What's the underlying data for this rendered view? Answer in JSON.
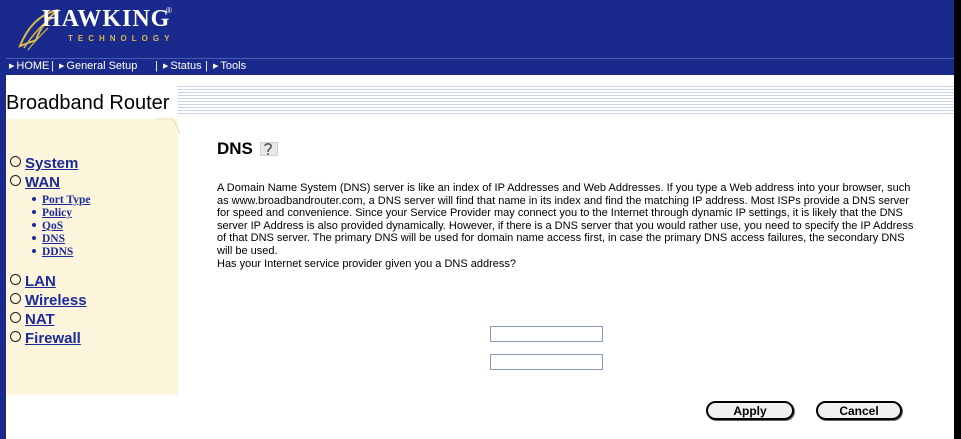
{
  "brand": {
    "logo_name": "HAWKING",
    "logo_sub": "TECHNOLOGY",
    "registered": "®",
    "logo_icon": "hawk-feather-icon"
  },
  "nav": {
    "items": [
      {
        "label": "HOME"
      },
      {
        "label": "General Setup"
      },
      {
        "label": "Status"
      },
      {
        "label": "Tools"
      }
    ],
    "separator": "|"
  },
  "product": {
    "title": "Broadband Router"
  },
  "sidebar": {
    "menu": [
      {
        "label": "System"
      },
      {
        "label": "WAN"
      },
      {
        "label": "LAN"
      },
      {
        "label": "Wireless"
      },
      {
        "label": "NAT"
      },
      {
        "label": "Firewall"
      }
    ],
    "wan_sub": [
      {
        "label": "Port Type"
      },
      {
        "label": "Policy"
      },
      {
        "label": "QoS"
      },
      {
        "label": "DNS"
      },
      {
        "label": "DDNS"
      }
    ]
  },
  "main": {
    "title": "DNS",
    "help_icon": "help-icon",
    "description": "A Domain Name System (DNS) server is like an index of IP Addresses and Web Addresses. If you type a Web address into your browser, such as www.broadbandrouter.com, a DNS server will find that name in its index and find the matching IP address. Most ISPs provide a DNS server for speed and convenience. Since your Service Provider may connect you to the Internet through dynamic IP settings, it is likely that the DNS server IP Address is also provided dynamically. However, if there is a DNS server that you would rather use, you need to specify the IP Address of that DNS server. The primary DNS will be used for domain name access first, in case the primary DNS access failures, the secondary DNS will be used.",
    "question": "Has your Internet service provider given you a DNS address?",
    "primary_dns": "",
    "secondary_dns": ""
  },
  "buttons": {
    "apply": "Apply",
    "cancel": "Cancel"
  },
  "colors": {
    "header_bg": "#1a2a8c",
    "sidebar_bg": "#fdf6dc",
    "link": "#1a2a9c"
  }
}
